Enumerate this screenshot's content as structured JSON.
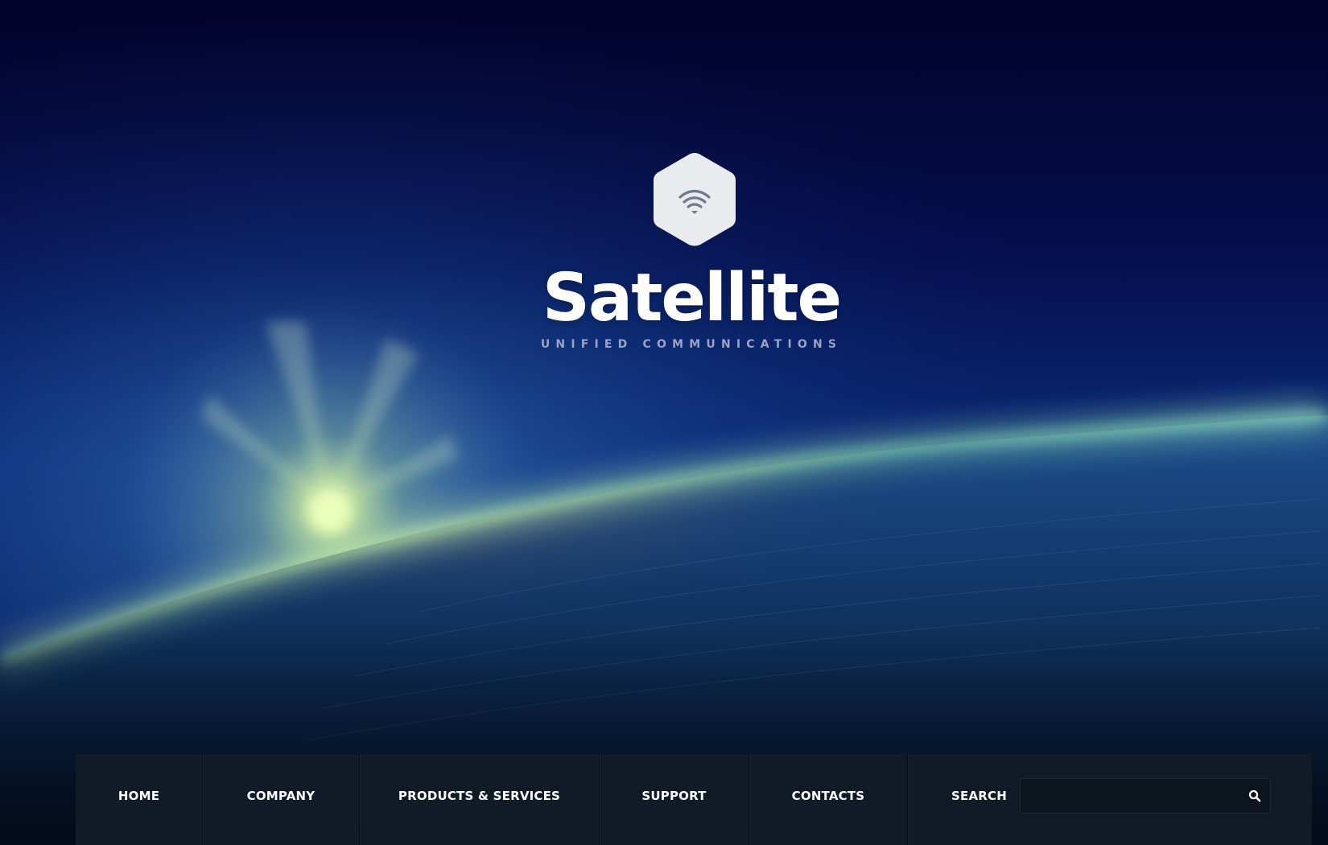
{
  "brand": {
    "title": "Satellite",
    "subtitle": "UNIFIED COMMUNICATIONS",
    "logo_icon": "wifi-icon"
  },
  "nav": {
    "items": [
      {
        "label": "HOME"
      },
      {
        "label": "COMPANY"
      },
      {
        "label": "PRODUCTS & SERVICES"
      },
      {
        "label": "SUPPORT"
      },
      {
        "label": "CONTACTS"
      }
    ],
    "search_label": "SEARCH",
    "search_placeholder": "",
    "search_value": "",
    "search_icon": "search-icon"
  },
  "colors": {
    "sky": "#02062a",
    "horizon_glow": "#8fe8b0",
    "sun": "#e8ffb0",
    "navbar": "#121c28",
    "logo_hex": "#e9ebee",
    "logo_icon": "#6f7a8a",
    "subtitle": "#9aa2c8"
  }
}
